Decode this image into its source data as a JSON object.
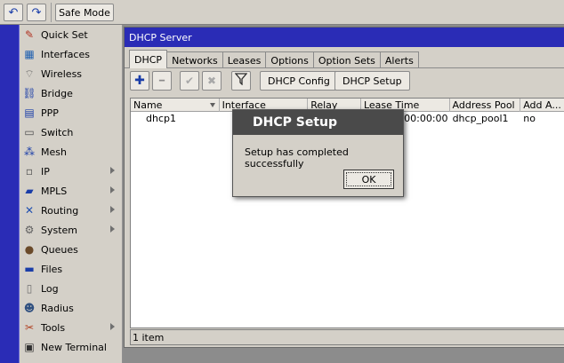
{
  "toolbar": {
    "undo_icon": "↶",
    "redo_icon": "↷",
    "safe_mode_label": "Safe Mode"
  },
  "sidebar": {
    "items": [
      {
        "label": "Quick Set",
        "icon": "quick-set-icon",
        "glyph": "✎",
        "submenu": false
      },
      {
        "label": "Interfaces",
        "icon": "interfaces-icon",
        "glyph": "▦",
        "submenu": false
      },
      {
        "label": "Wireless",
        "icon": "wireless-icon",
        "glyph": "⌔",
        "submenu": false
      },
      {
        "label": "Bridge",
        "icon": "bridge-icon",
        "glyph": "⛓",
        "submenu": false
      },
      {
        "label": "PPP",
        "icon": "ppp-icon",
        "glyph": "▤",
        "submenu": false
      },
      {
        "label": "Switch",
        "icon": "switch-icon",
        "glyph": "▭",
        "submenu": false
      },
      {
        "label": "Mesh",
        "icon": "mesh-icon",
        "glyph": "⁂",
        "submenu": false
      },
      {
        "label": "IP",
        "icon": "ip-icon",
        "glyph": "▫",
        "submenu": true
      },
      {
        "label": "MPLS",
        "icon": "mpls-icon",
        "glyph": "▰",
        "submenu": true
      },
      {
        "label": "Routing",
        "icon": "routing-icon",
        "glyph": "✕",
        "submenu": true
      },
      {
        "label": "System",
        "icon": "system-icon",
        "glyph": "⚙",
        "submenu": true
      },
      {
        "label": "Queues",
        "icon": "queues-icon",
        "glyph": "●",
        "submenu": false
      },
      {
        "label": "Files",
        "icon": "files-icon",
        "glyph": "▬",
        "submenu": false
      },
      {
        "label": "Log",
        "icon": "log-icon",
        "glyph": "▯",
        "submenu": false
      },
      {
        "label": "Radius",
        "icon": "radius-icon",
        "glyph": "☻",
        "submenu": false
      },
      {
        "label": "Tools",
        "icon": "tools-icon",
        "glyph": "✂",
        "submenu": true
      },
      {
        "label": "New Terminal",
        "icon": "terminal-icon",
        "glyph": "▣",
        "submenu": false
      }
    ]
  },
  "window": {
    "title": "DHCP Server",
    "tabs": [
      "DHCP",
      "Networks",
      "Leases",
      "Options",
      "Option Sets",
      "Alerts"
    ],
    "active_tab": 0,
    "buttons": {
      "add_icon": "✚",
      "remove_icon": "━",
      "enable_icon": "✔",
      "disable_icon": "✖",
      "filter_icon": "⛉",
      "dhcp_config": "DHCP Config",
      "dhcp_setup": "DHCP Setup"
    },
    "table": {
      "columns": [
        "Name",
        "Interface",
        "Relay",
        "Lease Time",
        "Address Pool",
        "Add A..."
      ],
      "rows": [
        [
          "dhcp1",
          "",
          "",
          "1d 00:00:00",
          "dhcp_pool1",
          "no"
        ]
      ]
    },
    "status": "1 item"
  },
  "dialog": {
    "title": "DHCP Setup",
    "message": "Setup has completed successfully",
    "ok_label": "OK"
  },
  "colors": {
    "accent_blue": "#2a2cb6",
    "panel": "#d4d0c8",
    "dialog_title": "#4a4a4a",
    "icon_blue": "#1a3da8"
  }
}
